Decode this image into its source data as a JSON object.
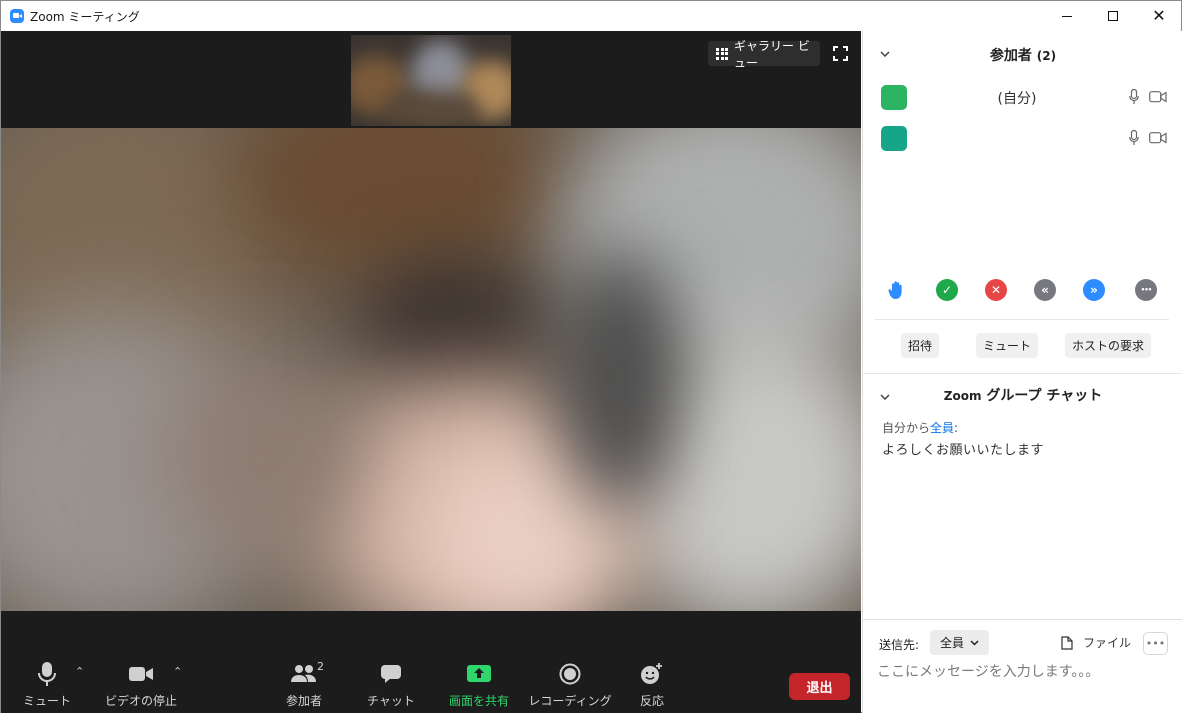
{
  "window": {
    "title": "Zoom ミーティング",
    "controls": {
      "minimize_icon": "minimize-icon",
      "maximize_icon": "maximize-icon",
      "close_glyph": "✕"
    }
  },
  "video": {
    "gallery_view_label": "ギャラリー ビュー",
    "fullscreen_icon": "fullscreen-icon"
  },
  "toolbar": {
    "mute_label": "ミュート",
    "video_label": "ビデオの停止",
    "participants_label": "参加者",
    "participants_count": "2",
    "chat_label": "チャット",
    "share_label": "画面を共有",
    "record_label": "レコーディング",
    "reactions_label": "反応",
    "leave_label": "退出",
    "caret": "⌃",
    "colors": {
      "share_accent": "#2fd66b",
      "leave_bg": "#c3252b"
    }
  },
  "participants_panel": {
    "title": "参加者",
    "count": "(2)",
    "participants": [
      {
        "name": "(自分)",
        "avatar_color": "#2cb462"
      },
      {
        "name": "",
        "avatar_color": "#17a589"
      }
    ],
    "reactions": [
      {
        "icon": "raise-hand-icon",
        "color": "#2d8cff"
      },
      {
        "icon": "yes-icon",
        "color": "#1fa94a",
        "glyph": "✓"
      },
      {
        "icon": "no-icon",
        "color": "#e64646",
        "glyph": "✕"
      },
      {
        "icon": "go-slower-icon",
        "color": "#777780",
        "glyph": "«"
      },
      {
        "icon": "go-faster-icon",
        "color": "#2d8cff",
        "glyph": "»"
      },
      {
        "icon": "more-icon",
        "color": "#777780",
        "glyph": "•••"
      }
    ],
    "invite_label": "招待",
    "mute_all_label": "ミュート",
    "request_host_label": "ホストの要求"
  },
  "chat_panel": {
    "title_prefix": "Zoom",
    "title_main": "グループ チャット",
    "messages": [
      {
        "from": "自分から",
        "to": "全員",
        "suffix": ":",
        "text": "よろしくお願いいたします"
      }
    ],
    "send_to_label": "送信先:",
    "send_to_value": "全員",
    "file_label": "ファイル",
    "more_label": "•••",
    "input_placeholder": "ここにメッセージを入力します。。。"
  }
}
